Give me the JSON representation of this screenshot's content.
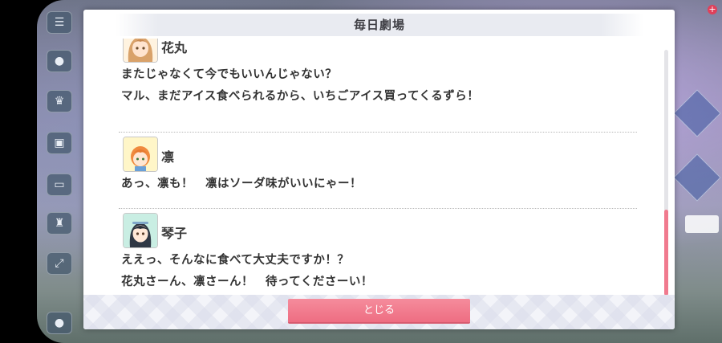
{
  "dialog": {
    "title": "毎日劇場",
    "close_label": "とじる"
  },
  "entries": [
    {
      "speaker": "花丸",
      "avatar_color": "#f6c98f",
      "lines": [
        "またじゃなくて今でもいいんじゃない？",
        "マル、まだアイス食べられるから、いちごアイス買ってくるずら！"
      ]
    },
    {
      "speaker": "凛",
      "avatar_color": "#f39b52",
      "lines": [
        "あっ、凛も！　凛はソーダ味がいいにゃー！"
      ]
    },
    {
      "speaker": "琴子",
      "avatar_color": "#3a4452",
      "lines": [
        "ええっ、そんなに食べて大丈夫ですか！？",
        "花丸さーん、凛さーん！　待ってくださーい！"
      ]
    }
  ],
  "scroll": {
    "position": 1.0
  },
  "colors": {
    "accent": "#ee6d82",
    "header_bg": "#e9ebf1"
  }
}
